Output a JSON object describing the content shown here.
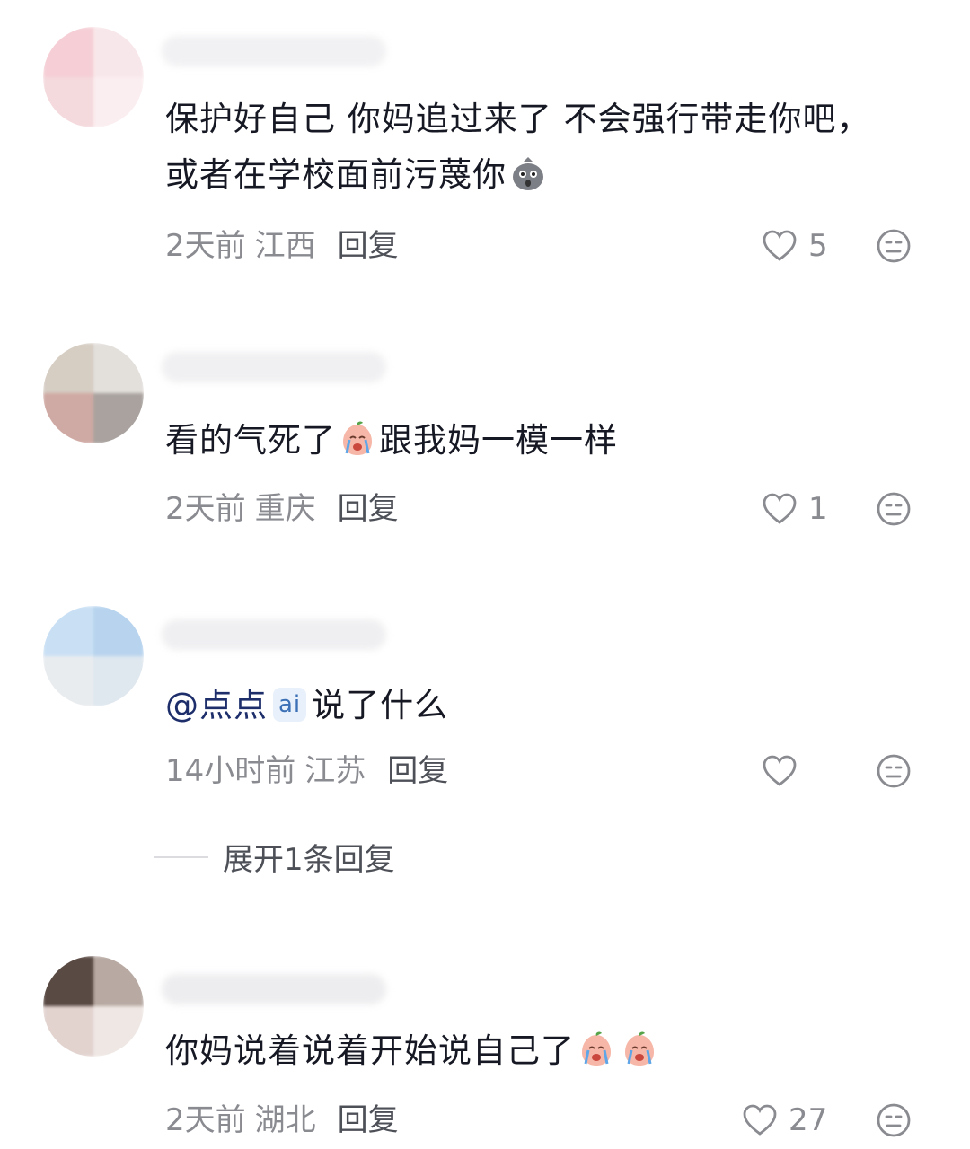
{
  "comments": [
    {
      "text": "保护好自己 你妈追过来了 不会强行带走你吧，或者在学校面前污蔑你",
      "emoji_icons": [
        "shocked-rock-icon"
      ],
      "time": "2天前",
      "location": "江西",
      "reply_label": "回复",
      "likes": "5"
    },
    {
      "text": "看的气死了",
      "text_after_emoji": "跟我妈一模一样",
      "emoji_icons": [
        "crying-peach-icon"
      ],
      "time": "2天前",
      "location": "重庆",
      "reply_label": "回复",
      "likes": "1"
    },
    {
      "mention": "@点点",
      "ai_tag": "ai",
      "text": "说了什么",
      "time": "14小时前",
      "location": "江苏",
      "reply_label": "回复",
      "likes": "",
      "expand_label": "展开1条回复"
    },
    {
      "text": "你妈说着说着开始说自己了",
      "emoji_icons": [
        "crying-peach-icon",
        "crying-peach-icon"
      ],
      "time": "2天前",
      "location": "湖北",
      "reply_label": "回复",
      "likes": "27"
    }
  ]
}
